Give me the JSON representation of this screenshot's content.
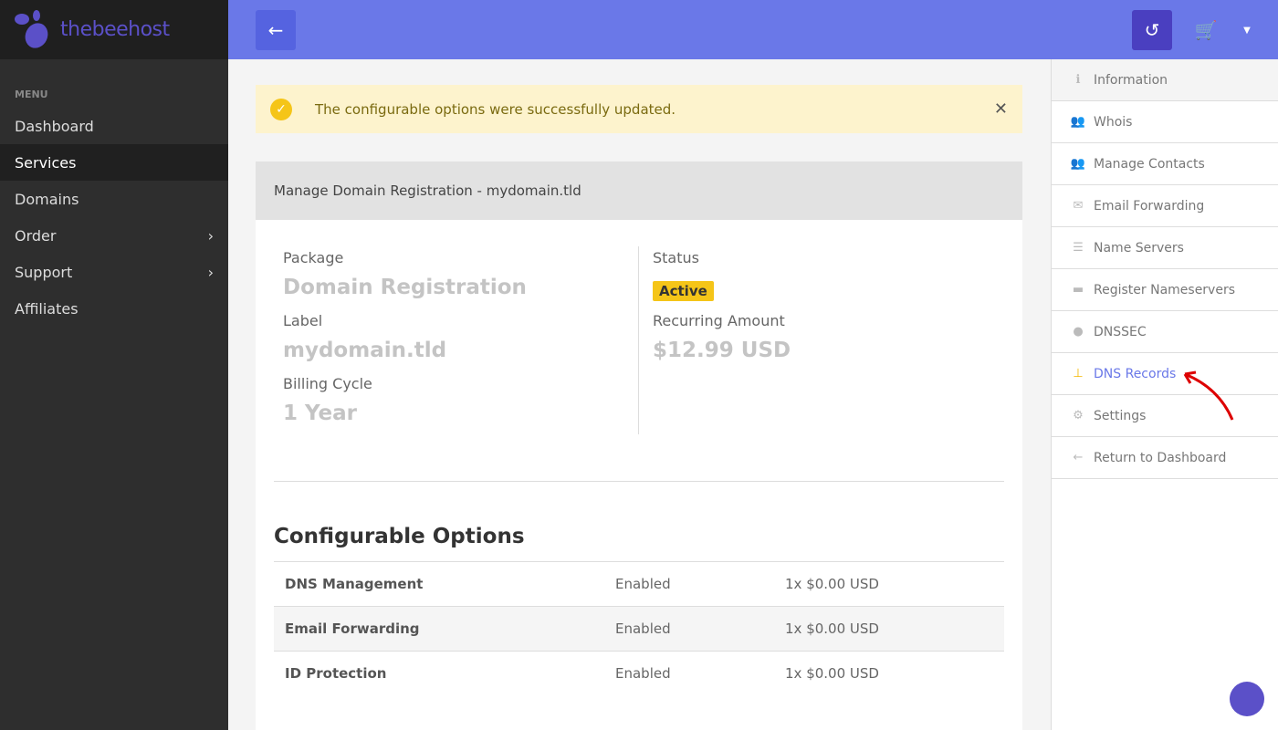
{
  "brand": {
    "pre": "thebee",
    "post": "host"
  },
  "sidebar": {
    "heading": "MENU",
    "items": [
      {
        "label": "Dashboard"
      },
      {
        "label": "Services"
      },
      {
        "label": "Domains"
      },
      {
        "label": "Order"
      },
      {
        "label": "Support"
      },
      {
        "label": "Affiliates"
      }
    ]
  },
  "alert": {
    "message": "The configurable options were successfully updated."
  },
  "card": {
    "title": "Manage Domain Registration - mydomain.tld",
    "package_label": "Package",
    "package": "Domain Registration",
    "label_label": "Label",
    "label": "mydomain.tld",
    "cycle_label": "Billing Cycle",
    "cycle": "1 Year",
    "status_label": "Status",
    "status": "Active",
    "amount_label": "Recurring Amount",
    "amount": "$12.99 USD"
  },
  "options": {
    "title": "Configurable Options",
    "rows": [
      {
        "name": "DNS Management",
        "state": "Enabled",
        "price": "1x $0.00 USD"
      },
      {
        "name": "Email Forwarding",
        "state": "Enabled",
        "price": "1x $0.00 USD"
      },
      {
        "name": "ID Protection",
        "state": "Enabled",
        "price": "1x $0.00 USD"
      }
    ]
  },
  "right": {
    "items": [
      {
        "label": "Information"
      },
      {
        "label": "Whois"
      },
      {
        "label": "Manage Contacts"
      },
      {
        "label": "Email Forwarding"
      },
      {
        "label": "Name Servers"
      },
      {
        "label": "Register Nameservers"
      },
      {
        "label": "DNSSEC"
      },
      {
        "label": "DNS Records"
      },
      {
        "label": "Settings"
      },
      {
        "label": "Return to Dashboard"
      }
    ]
  }
}
